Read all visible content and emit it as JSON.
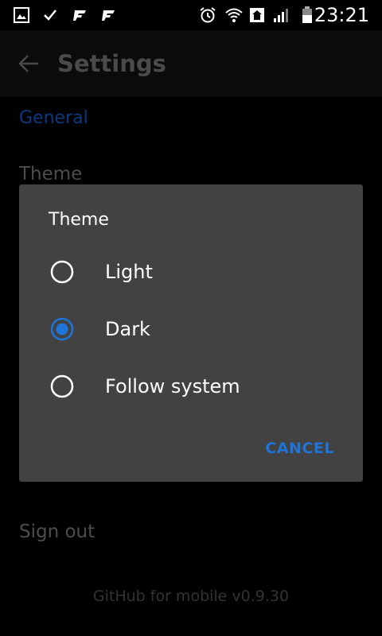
{
  "status_bar": {
    "time": "23:21",
    "icons": [
      "image-icon",
      "check-icon",
      "app-f-icon",
      "app-f-icon",
      "alarm-icon",
      "wifi-icon",
      "home-icon",
      "signal-icon",
      "battery-icon"
    ]
  },
  "app_bar": {
    "title": "Settings",
    "back_icon": "arrow-left-icon"
  },
  "settings": {
    "section_header": "General",
    "theme_label": "Theme",
    "sign_out_label": "Sign out",
    "version_text": "GitHub for mobile v0.9.30"
  },
  "dialog": {
    "title": "Theme",
    "options": [
      {
        "label": "Light",
        "selected": false
      },
      {
        "label": "Dark",
        "selected": true
      },
      {
        "label": "Follow system",
        "selected": false
      }
    ],
    "cancel_label": "CANCEL"
  },
  "colors": {
    "accent": "#1e74d8",
    "dialog_background": "#424242",
    "background": "#000000"
  }
}
